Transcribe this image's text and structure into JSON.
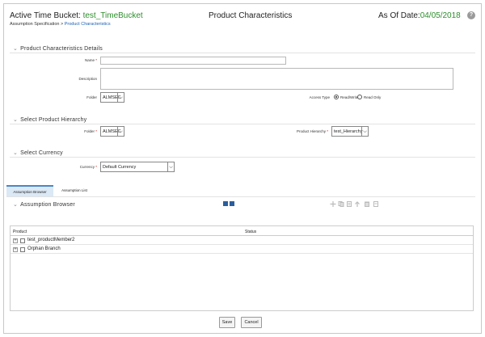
{
  "header": {
    "bucket_label": "Active Time Bucket: ",
    "bucket_value": "test_TimeBucket",
    "title": "Product Characteristics",
    "as_of_label": "As Of Date:",
    "as_of_value": "04/05/2018",
    "help_icon": "help-icon"
  },
  "breadcrumb": {
    "parent": "Assumption Specification",
    "sep": " > ",
    "current": "Product Characteristics"
  },
  "details": {
    "title": "Product Characteristics Details",
    "name_label": "Name",
    "name_value": "",
    "description_label": "Description",
    "description_value": "",
    "folder_label": "Folder",
    "folder_value": "ALMSEC",
    "access_type_label": "Access Type",
    "access_options": [
      "Read/Write",
      "Read Only"
    ],
    "access_selected": "Read/Write"
  },
  "hierarchy": {
    "title": "Select Product Hierarchy",
    "folder_label": "Folder",
    "folder_value": "ALMSEC",
    "hierarchy_label": "Product Hierarchy",
    "hierarchy_value": "test_Hierarchy"
  },
  "currency": {
    "title": "Select Currency",
    "currency_label": "Currency",
    "currency_value": "Default Currency"
  },
  "tabs": [
    {
      "label": "Assumption Browser",
      "active": true
    },
    {
      "label": "Assumption List",
      "active": false
    }
  ],
  "browser": {
    "title": "Assumption Browser",
    "toolbar_icons": [
      "add-icon",
      "copy-icon",
      "edit-icon",
      "upload-icon",
      "delete-icon",
      "refresh-icon"
    ],
    "columns": [
      "Product",
      "Status"
    ],
    "rows": [
      {
        "product": "test_productMember2",
        "status": ""
      },
      {
        "product": "Orphan Branch",
        "status": ""
      }
    ]
  },
  "buttons": {
    "save": "Save",
    "cancel": "Cancel"
  },
  "colors": {
    "accent_green": "#2d8f2d",
    "link_blue": "#1a5fb4",
    "tab_active": "#dbe8f5"
  }
}
